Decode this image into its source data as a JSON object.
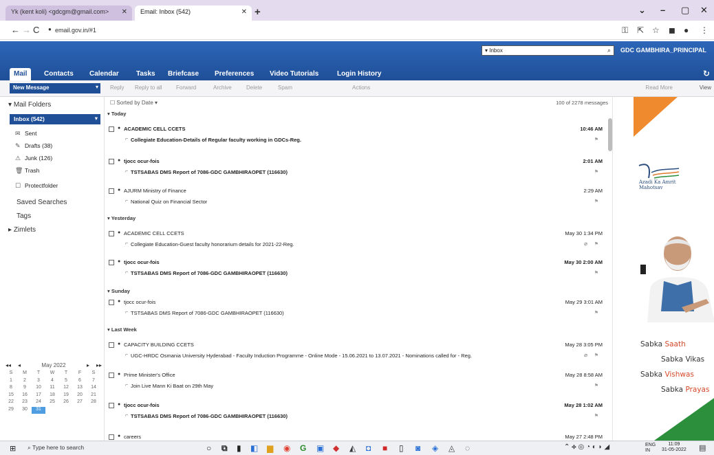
{
  "browser": {
    "tabs": [
      {
        "label": "Yk (kent koli) <gdcgm@gmail.com>"
      },
      {
        "label": "Email: Inbox (542)"
      }
    ],
    "url": "email.gov.in/#1"
  },
  "header": {
    "search_value": "Inbox",
    "search_scope": "▾",
    "user": "GDC GAMBHIRA_PRINCIPAL",
    "tabs": [
      "Mail",
      "Contacts",
      "Calendar",
      "Tasks",
      "Briefcase",
      "Preferences",
      "Video Tutorials",
      "Login History"
    ]
  },
  "toolbar": {
    "new_message": "New Message",
    "buttons": [
      "Reply",
      "Reply to all",
      "Forward",
      "Archive",
      "Delete",
      "Spam",
      "Actions"
    ],
    "read_more": "Read More",
    "view": "View"
  },
  "sidebar": {
    "mail_folders": "Mail Folders",
    "inbox": "Inbox (542)",
    "folders": [
      {
        "icon": "✉",
        "label": "Sent"
      },
      {
        "icon": "✎",
        "label": "Drafts (38)"
      },
      {
        "icon": "⚠",
        "label": "Junk (126)"
      },
      {
        "icon": "🗑",
        "label": "Trash"
      },
      {
        "icon": "☐",
        "label": "Protectfolder"
      }
    ],
    "saved_searches": "Saved Searches",
    "tags": "Tags",
    "zimlets": "Zimlets"
  },
  "calendar": {
    "month": "May 2022",
    "weeks": [
      [
        "S",
        "M",
        "T",
        "W",
        "T",
        "F",
        "S"
      ],
      [
        "1",
        "2",
        "3",
        "4",
        "5",
        "6",
        "7"
      ],
      [
        "8",
        "9",
        "10",
        "11",
        "12",
        "13",
        "14"
      ],
      [
        "15",
        "16",
        "17",
        "18",
        "19",
        "20",
        "21"
      ],
      [
        "22",
        "23",
        "24",
        "25",
        "26",
        "27",
        "28"
      ],
      [
        "29",
        "30",
        "31",
        "",
        "",
        "",
        ""
      ]
    ],
    "today": "31"
  },
  "list": {
    "sorted_by": "Sorted by Date",
    "count": "100 of 2278 messages",
    "groups": {
      "today": "Today",
      "yesterday": "Yesterday",
      "sunday": "Sunday",
      "last_week": "Last Week"
    },
    "messages": [
      {
        "from": "ACADEMIC CELL CCETS",
        "date": "10:46 AM",
        "subject": "Collegiate Education-Details of Regular faculty working in GDCs-Reg.",
        "unread": true
      },
      {
        "from": "tjocc ocur-fois",
        "date": "2:01 AM",
        "subject": "TSTSABAS DMS Report of 7086-GDC GAMBHIRAOPET (116630)",
        "unread": true
      },
      {
        "from": "AJURM Ministry of Finance",
        "date": "2:29 AM",
        "subject": "National Quiz on Financial Sector",
        "unread": false
      },
      {
        "from": "ACADEMIC CELL CCETS",
        "date": "May 30 1:34 PM",
        "subject": "Collegiate Education-Guest faculty honorarium details for 2021-22-Reg.",
        "unread": false
      },
      {
        "from": "tjocc ocur-fois",
        "date": "May 30 2:00 AM",
        "subject": "TSTSABAS DMS Report of 7086-GDC GAMBHIRAOPET (116630)",
        "unread": true
      },
      {
        "from": "tjocc ocur-fois",
        "date": "May 29 3:01 AM",
        "subject": "TSTSABAS DMS Report of 7086-GDC GAMBHIRAOPET (116630)",
        "unread": false
      },
      {
        "from": "CAPACITY BUILDING CCETS",
        "date": "May 28 3:05 PM",
        "subject": "UGC-HRDC Osmania University Hyderabad - Faculty Induction Programme - Online Mode - 15.06.2021 to 13.07.2021 - Nominations called for - Reg.",
        "unread": false
      },
      {
        "from": "Prime Minister's Office",
        "date": "May 28 8:58 AM",
        "subject": "Join Live Mann Ki Baat on 29th May",
        "unread": false
      },
      {
        "from": "tjocc ocur-fois",
        "date": "May 28 1:02 AM",
        "subject": "TSTSABAS DMS Report of 7086-GDC GAMBHIRAOPET (116630)",
        "unread": true
      },
      {
        "from": "careers",
        "date": "May 27 2:48 PM",
        "subject": "",
        "unread": false
      }
    ]
  },
  "ad": {
    "azadi": "Azadi Ka Amrit Mahotsav",
    "s1a": "Sabka ",
    "s1b": "Saath",
    "s2a": "Sabka ",
    "s2b": "Vikas",
    "s3a": "Sabka ",
    "s3b": "Vishwas",
    "s4a": "Sabka ",
    "s4b": "Prayas"
  },
  "taskbar": {
    "search": "Type here to search",
    "lang": "ENG",
    "lang2": "IN",
    "time": "11:09",
    "date": "31-05-2022"
  }
}
